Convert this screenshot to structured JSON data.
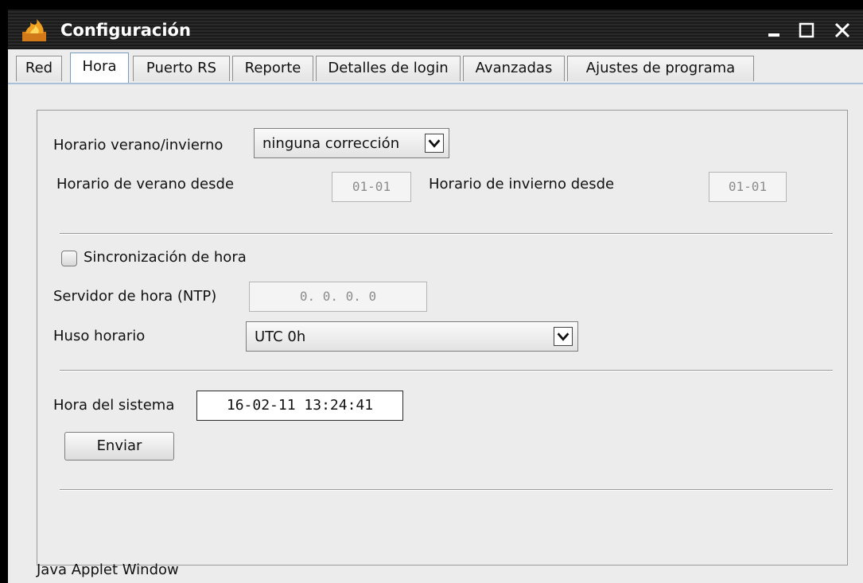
{
  "window": {
    "title": "Configuración",
    "icon": "java-flame-icon",
    "controls": [
      "minimize-icon",
      "maximize-icon",
      "close-icon"
    ]
  },
  "tabs": [
    {
      "label": "Red"
    },
    {
      "label": "Hora"
    },
    {
      "label": "Puerto RS"
    },
    {
      "label": "Reporte"
    },
    {
      "label": "Detalles de login"
    },
    {
      "label": "Avanzadas"
    },
    {
      "label": "Ajustes de programa"
    }
  ],
  "active_tab": "Hora",
  "dst": {
    "label": "Horario verano/invierno",
    "select_value": "ninguna corrección",
    "summer_label": "Horario de verano desde",
    "summer_value": "01-01",
    "winter_label": "Horario de invierno desde",
    "winter_value": "01-01"
  },
  "sync": {
    "checkbox_label": "Sincronización de hora",
    "checked": false,
    "ntp_label": "Servidor de hora (NTP)",
    "ntp_value": "0.  0.  0.  0",
    "tz_label": "Huso horario",
    "tz_value": "UTC 0h"
  },
  "system_time": {
    "label": "Hora del sistema",
    "value": "16-02-11 13:24:41",
    "send_label": "Enviar"
  },
  "status": {
    "text": "Java Applet Window"
  },
  "colors": {
    "titlebar": "#1a1a1a",
    "panel_bg": "#ececec",
    "tab_active_border": "#7b9ac0"
  }
}
